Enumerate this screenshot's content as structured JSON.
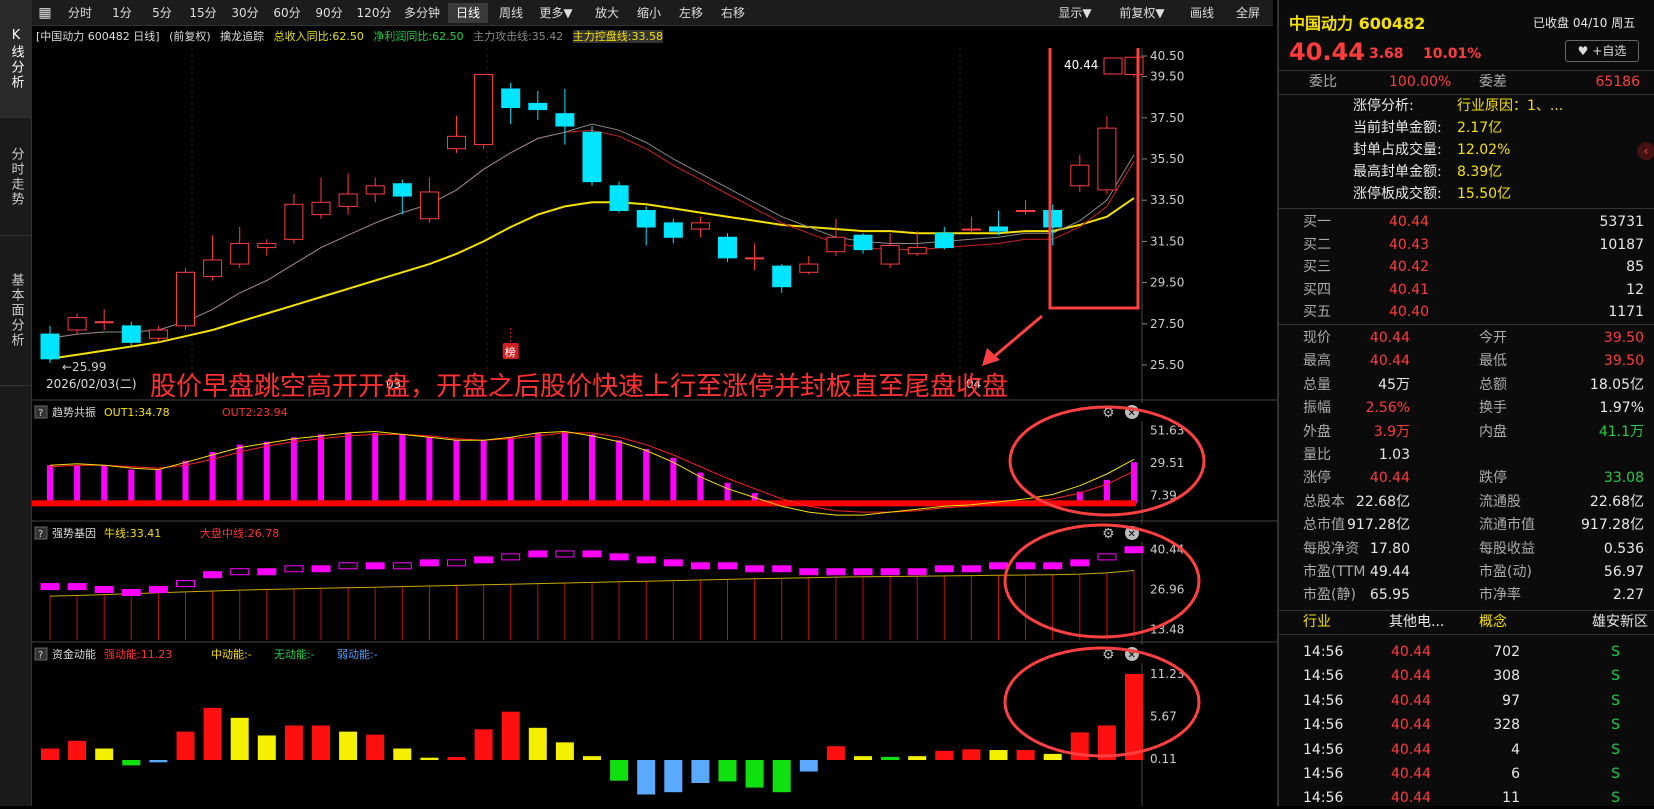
{
  "nav_left": [
    "K线分析",
    "分时走势",
    "基本面分析"
  ],
  "toolbar": {
    "periods": [
      "分时",
      "1分",
      "5分",
      "15分",
      "30分",
      "60分",
      "90分",
      "120分",
      "多分钟",
      "日线",
      "周线",
      "更多▼",
      "放大",
      "缩小",
      "左移",
      "右移"
    ],
    "selected": "日线",
    "right": [
      "显示▼",
      "前复权▼",
      "画线",
      "全屏"
    ]
  },
  "info": {
    "stock": "[中国动力 600482 日线]",
    "fq": "(前复权)",
    "indicator": "擒龙追踪",
    "v1": "总收入同比:62.50",
    "v2": "净利润同比:62.50",
    "v3": "主力攻击线:35.42",
    "v4": "主力控盘线:33.58"
  },
  "main_chart": {
    "yticks": [
      "40.50",
      "39.50",
      "37.50",
      "35.50",
      "33.50",
      "31.50",
      "29.50",
      "27.50",
      "25.50"
    ],
    "date_label": "2026/02/03(二)",
    "month_label_1": "03",
    "month_label_2": "04",
    "low_marker": "25.99",
    "price_box": "40.44",
    "bang": "榜",
    "annotation": "股价早盘跳空高开开盘，开盘之后股价快速上行至涨停并封板直至尾盘收盘"
  },
  "chart_data": {
    "type": "candlestick",
    "ylim": [
      25.5,
      40.5
    ],
    "candles": [
      [
        27.0,
        25.8,
        27.4,
        25.6
      ],
      [
        27.2,
        27.8,
        28.0,
        27.0
      ],
      [
        27.6,
        27.6,
        28.2,
        27.2
      ],
      [
        27.4,
        26.6,
        27.6,
        26.4
      ],
      [
        26.8,
        27.2,
        27.4,
        26.6
      ],
      [
        27.4,
        30.0,
        30.2,
        27.2
      ],
      [
        29.8,
        30.6,
        31.8,
        29.6
      ],
      [
        30.4,
        31.4,
        32.2,
        30.2
      ],
      [
        31.2,
        31.4,
        31.6,
        30.8
      ],
      [
        31.6,
        33.3,
        33.8,
        31.4
      ],
      [
        32.8,
        33.4,
        34.6,
        32.6
      ],
      [
        33.2,
        33.8,
        34.8,
        32.8
      ],
      [
        33.8,
        34.2,
        34.6,
        33.4
      ],
      [
        34.3,
        33.7,
        34.5,
        32.8
      ],
      [
        32.6,
        33.9,
        34.6,
        32.4
      ],
      [
        36.0,
        36.6,
        37.6,
        35.8
      ],
      [
        36.2,
        39.6,
        39.6,
        36.0
      ],
      [
        38.9,
        38.0,
        39.2,
        37.2
      ],
      [
        38.2,
        37.9,
        38.8,
        37.4
      ],
      [
        37.7,
        37.1,
        38.9,
        36.2
      ],
      [
        36.8,
        34.4,
        37.1,
        34.2
      ],
      [
        34.2,
        33.0,
        34.4,
        32.9
      ],
      [
        33.0,
        32.2,
        33.2,
        31.3
      ],
      [
        32.4,
        31.7,
        32.6,
        31.4
      ],
      [
        32.1,
        32.4,
        32.7,
        31.7
      ],
      [
        31.7,
        30.7,
        31.9,
        30.5
      ],
      [
        30.7,
        30.7,
        31.4,
        30.1
      ],
      [
        30.3,
        29.3,
        30.4,
        29.0
      ],
      [
        30.0,
        30.4,
        30.8,
        29.9
      ],
      [
        31.0,
        31.7,
        32.6,
        30.8
      ],
      [
        31.8,
        31.1,
        31.9,
        30.9
      ],
      [
        30.4,
        31.3,
        31.9,
        30.2
      ],
      [
        30.9,
        31.2,
        32.0,
        30.8
      ],
      [
        31.9,
        31.2,
        32.2,
        31.1
      ],
      [
        32.1,
        32.1,
        32.7,
        31.9
      ],
      [
        32.2,
        32.0,
        33.0,
        31.8
      ],
      [
        33.0,
        33.0,
        33.5,
        32.8
      ],
      [
        33.0,
        32.2,
        33.3,
        31.3
      ],
      [
        34.2,
        35.2,
        35.7,
        33.9
      ],
      [
        34.0,
        37.0,
        37.6,
        33.8
      ],
      [
        39.6,
        40.44,
        40.44,
        39.5
      ]
    ],
    "ma_red": [
      26.8,
      27.0,
      27.1,
      27.1,
      27.2,
      27.6,
      28.2,
      29.0,
      29.6,
      30.4,
      31.2,
      31.8,
      32.4,
      32.9,
      33.3,
      34.0,
      35.0,
      35.8,
      36.5,
      36.8,
      36.9,
      36.6,
      36.0,
      35.2,
      34.5,
      33.8,
      33.1,
      32.4,
      31.9,
      31.4,
      31.2,
      31.1,
      31.1,
      31.2,
      31.3,
      31.4,
      31.6,
      31.6,
      32.2,
      33.2,
      35.4
    ],
    "ma_yellow": [
      25.8,
      26.0,
      26.2,
      26.4,
      26.6,
      26.9,
      27.2,
      27.6,
      28.0,
      28.4,
      28.8,
      29.2,
      29.6,
      30.0,
      30.4,
      30.9,
      31.5,
      32.2,
      32.8,
      33.2,
      33.4,
      33.4,
      33.3,
      33.1,
      32.9,
      32.7,
      32.5,
      32.3,
      32.2,
      32.1,
      32.0,
      32.0,
      31.9,
      31.9,
      31.9,
      31.9,
      32.0,
      32.0,
      32.3,
      32.7,
      33.6
    ]
  },
  "sub1": {
    "name": "趋势共振",
    "out1": "OUT1:34.78",
    "out2": "OUT2:23.94",
    "yticks": [
      "51.63",
      "29.51",
      "7.39"
    ],
    "values": [
      28,
      28,
      28,
      25,
      25,
      31,
      37,
      42,
      44,
      47,
      49,
      50,
      50,
      49,
      47,
      45,
      45,
      47,
      50,
      51,
      49,
      45,
      39,
      33,
      23,
      16,
      9,
      3,
      1,
      1,
      1,
      1,
      1,
      1,
      1,
      1,
      2,
      4,
      10,
      18,
      30
    ],
    "yellow": [
      28,
      29,
      28,
      26,
      25,
      30,
      35,
      40,
      43,
      46,
      48,
      50,
      51,
      49,
      47,
      45,
      45,
      47,
      50,
      51,
      48,
      44,
      38,
      30,
      20,
      12,
      6,
      0,
      -4,
      -6,
      -6,
      -4,
      -2,
      0,
      1,
      3,
      5,
      8,
      14,
      22,
      32
    ],
    "red": [
      27,
      28,
      28,
      27,
      26,
      28,
      32,
      37,
      41,
      44,
      46,
      48,
      49,
      49,
      48,
      46,
      45,
      46,
      48,
      50,
      50,
      47,
      42,
      35,
      27,
      19,
      12,
      5,
      0,
      -3,
      -4,
      -4,
      -3,
      -1,
      0,
      2,
      3,
      5,
      9,
      15,
      24
    ]
  },
  "sub2": {
    "name": "强势基因",
    "niu": "牛线:33.41",
    "dapan": "大盘中线:26.78",
    "yticks": [
      "40.44",
      "26.96",
      "13.48"
    ],
    "boxes": [
      28,
      28,
      27,
      26,
      27,
      29,
      32,
      33,
      33,
      34,
      34,
      35,
      35,
      35,
      36,
      36,
      37,
      38,
      39,
      39,
      39,
      38,
      37,
      36,
      35,
      35,
      34,
      34,
      33,
      33,
      33,
      33,
      33,
      34,
      34,
      35,
      35,
      35,
      36,
      38,
      40.4
    ],
    "line": [
      24.8,
      25,
      25.3,
      25.6,
      25.9,
      26.2,
      26.5,
      26.8,
      27,
      27.2,
      27.4,
      27.6,
      27.8,
      28,
      28.2,
      28.4,
      28.6,
      28.8,
      29,
      29.2,
      29.4,
      29.6,
      29.8,
      30,
      30.2,
      30.4,
      30.6,
      30.8,
      31,
      31.2,
      31.3,
      31.4,
      31.5,
      31.6,
      31.7,
      31.8,
      31.9,
      32.0,
      32.2,
      32.6,
      33.4
    ]
  },
  "sub3": {
    "name": "资金动能",
    "strong": "强动能:11.23",
    "mid": "中动能:-",
    "none": "无动能:-",
    "weak": "弱动能:-",
    "yticks": [
      "11.23",
      "5.67",
      "0.11"
    ],
    "values": [
      1.5,
      2.5,
      1.5,
      -0.7,
      -0.3,
      3.7,
      6.8,
      5.5,
      3.2,
      4.5,
      4.5,
      3.7,
      3.3,
      1.5,
      0.3,
      0.4,
      4.0,
      6.3,
      4.2,
      2.3,
      0.5,
      -2.7,
      -4.5,
      -4.2,
      -3.0,
      -2.8,
      -3.6,
      -4.2,
      -1.5,
      1.8,
      0.5,
      0.4,
      0.5,
      1.2,
      1.4,
      1.3,
      1.3,
      0.8,
      3.6,
      4.5,
      11.23
    ],
    "colors": [
      "r",
      "r",
      "y",
      "g",
      "b",
      "r",
      "r",
      "y",
      "y",
      "r",
      "r",
      "y",
      "r",
      "y",
      "y",
      "r",
      "r",
      "r",
      "y",
      "y",
      "y",
      "g",
      "b",
      "b",
      "b",
      "g",
      "g",
      "g",
      "b",
      "r",
      "y",
      "g",
      "y",
      "r",
      "r",
      "y",
      "r",
      "y",
      "r",
      "r",
      "r"
    ]
  },
  "right": {
    "name": "中国动力 600482",
    "status": "已收盘 04/10 周五",
    "price": "40.44",
    "chg": "3.68",
    "pct": "10.01%",
    "fav": "+自选",
    "weibi_label": "委比",
    "weibi": "100.00%",
    "weicha_label": "委差",
    "weicha": "65186",
    "zt_rows": [
      [
        "涨停分析:",
        "行业原因：1、..."
      ],
      [
        "当前封单金额:",
        "2.17亿"
      ],
      [
        "封单占成交量:",
        "12.02%"
      ],
      [
        "最高封单金额:",
        "8.39亿"
      ],
      [
        "涨停板成交额:",
        "15.50亿"
      ]
    ],
    "bids": [
      [
        "买一",
        "40.44",
        "53731"
      ],
      [
        "买二",
        "40.43",
        "10187"
      ],
      [
        "买三",
        "40.42",
        "85"
      ],
      [
        "买四",
        "40.41",
        "12"
      ],
      [
        "买五",
        "40.40",
        "1171"
      ]
    ],
    "quote": [
      [
        "现价",
        "40.44",
        "r",
        "今开",
        "39.50",
        "r"
      ],
      [
        "最高",
        "40.44",
        "r",
        "最低",
        "39.50",
        "r"
      ],
      [
        "总量",
        "45万",
        "w",
        "总额",
        "18.05亿",
        "w"
      ],
      [
        "振幅",
        "2.56%",
        "r",
        "换手",
        "1.97%",
        "w"
      ],
      [
        "外盘",
        "3.9万",
        "r",
        "内盘",
        "41.1万",
        "g"
      ],
      [
        "量比",
        "1.03",
        "w",
        "",
        "",
        ""
      ],
      [
        "涨停",
        "40.44",
        "r",
        "跌停",
        "33.08",
        "g"
      ],
      [
        "总股本",
        "22.68亿",
        "w",
        "流通股",
        "22.68亿",
        "w"
      ],
      [
        "总市值",
        "917.28亿",
        "w",
        "流通市值",
        "917.28亿",
        "w"
      ],
      [
        "每股净资",
        "17.80",
        "w",
        "每股收益",
        "0.536",
        "w"
      ],
      [
        "市盈(TTM",
        "49.44",
        "w",
        "市盈(动)",
        "56.97",
        "w"
      ],
      [
        "市盈(静)",
        "65.95",
        "w",
        "市净率",
        "2.27",
        "w"
      ]
    ],
    "industry": [
      "行业",
      "其他电...",
      "概念",
      "雄安新区"
    ],
    "ticks": [
      [
        "14:56",
        "40.44",
        "702",
        "S"
      ],
      [
        "14:56",
        "40.44",
        "308",
        "S"
      ],
      [
        "14:56",
        "40.44",
        "97",
        "S"
      ],
      [
        "14:56",
        "40.44",
        "328",
        "S"
      ],
      [
        "14:56",
        "40.44",
        "4",
        "S"
      ],
      [
        "14:56",
        "40.44",
        "6",
        "S"
      ],
      [
        "14:56",
        "40.44",
        "11",
        "S"
      ]
    ]
  }
}
